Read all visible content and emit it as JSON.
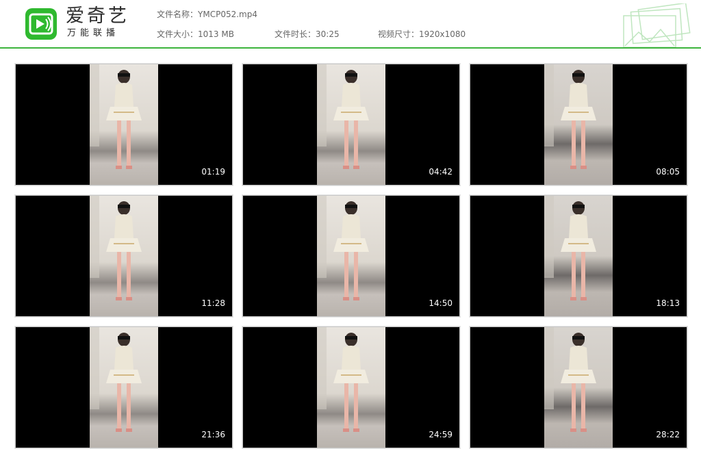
{
  "brand": {
    "logo_icon": "iqiyi-tv-icon",
    "name": "爱奇艺",
    "slogan": "万能联播",
    "accent_color": "#2fb92f"
  },
  "file_info": {
    "name_label": "文件名称：",
    "name_value": "YMCP052.mp4",
    "size_label": "文件大小：",
    "size_value": "1013 MB",
    "duration_label": "文件时长：",
    "duration_value": "30:25",
    "dimension_label": "视频尺寸：",
    "dimension_value": "1920x1080"
  },
  "thumbnails": [
    {
      "timestamp": "01:19"
    },
    {
      "timestamp": "04:42"
    },
    {
      "timestamp": "08:05"
    },
    {
      "timestamp": "11:28"
    },
    {
      "timestamp": "14:50"
    },
    {
      "timestamp": "18:13"
    },
    {
      "timestamp": "21:36"
    },
    {
      "timestamp": "24:59"
    },
    {
      "timestamp": "28:22"
    }
  ]
}
